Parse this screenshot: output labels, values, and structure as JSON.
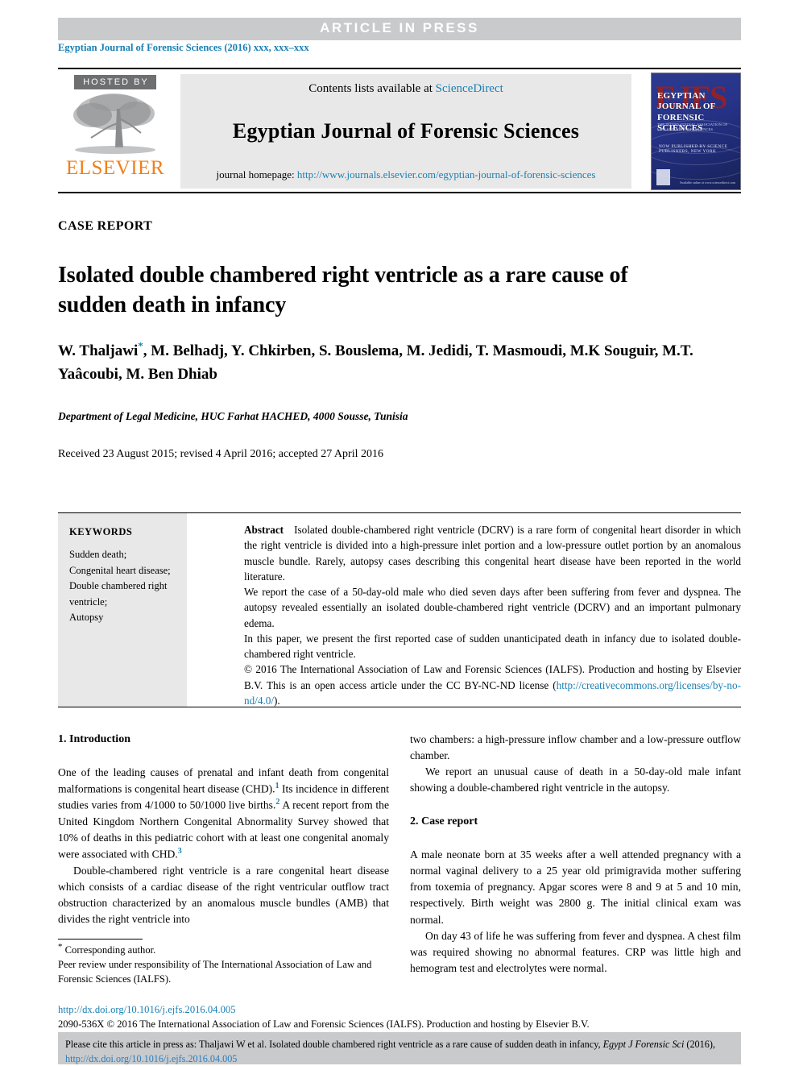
{
  "banner": {
    "text": "ARTICLE  IN  PRESS",
    "bg_color": "#c9cacc"
  },
  "issue_line": "Egyptian Journal of Forensic Sciences (2016) xxx, xxx–xxx",
  "masthead": {
    "hosted_by": "HOSTED BY",
    "publisher": "ELSEVIER",
    "contents_prefix": "Contents lists available at",
    "contents_link": "ScienceDirect",
    "journal_title": "Egyptian Journal of Forensic Sciences",
    "homepage_label": "journal homepage:",
    "homepage_url": "http://www.journals.elsevier.com/egyptian-journal-of-forensic-sciences",
    "cover": {
      "ghost_letters": "EJFS",
      "title": "EGYPTIAN JOURNAL OF FORENSIC SCIENCES",
      "subtitle": "THE INTERNATIONAL ASSOCIATION OF LAW AND FORENSIC SCIENCES",
      "middle_line": "NOW PUBLISHED BY SCIENCE PUBLISHERS, NEW YORK",
      "footer": "Available online at\nwww.sciencedirect.com"
    },
    "link_color": "#1a7fb3"
  },
  "article": {
    "type_label": "CASE REPORT",
    "title": "Isolated double chambered right ventricle as a rare cause of sudden death in infancy",
    "authors": "W. Thaljawi , M. Belhadj, Y. Chkirben, S. Bouslema, M. Jedidi, T. Masmoudi, M.K Souguir, M.T. Yaâcoubi, M. Ben Dhiab",
    "affiliation": "Department of Legal Medicine, HUC Farhat HACHED, 4000 Sousse, Tunisia",
    "dates": "Received 23 August 2015; revised 4 April 2016; accepted 27 April 2016"
  },
  "keywords": {
    "heading": "KEYWORDS",
    "items": [
      "Sudden death;",
      "Congenital heart disease;",
      "Double chambered right",
      "ventricle;",
      "Autopsy"
    ]
  },
  "abstract": {
    "label": "Abstract",
    "para1": "Isolated double-chambered right ventricle (DCRV) is a rare form of congenital heart disorder in which the right ventricle is divided into a high-pressure inlet portion and a low-pressure outlet portion by an anomalous muscle bundle. Rarely, autopsy cases describing this congenital heart disease have been reported in the world literature.",
    "para2": "We report the case of a 50-day-old male who died seven days after been suffering from fever and dyspnea. The autopsy revealed essentially an isolated double-chambered right ventricle (DCRV) and an important pulmonary edema.",
    "para3": "In this paper, we present the first reported case of sudden unanticipated death in infancy due to isolated double-chambered right ventricle.",
    "copyright": "© 2016 The International Association of Law and Forensic Sciences (IALFS). Production and hosting by Elsevier B.V. This is an open access article under the CC BY-NC-ND license (",
    "copyright_link": "http://creativecommons.org/licenses/by-no-nd/4.0/",
    "copyright_tail": ")."
  },
  "body": {
    "section1_heading": "1. Introduction",
    "left_p1_a": "One of the leading causes of prenatal and infant death from congenital malformations is congenital heart disease (CHD).",
    "left_p1_ref1": "1",
    "left_p1_b": " Its incidence in different studies varies from 4/1000 to 50/1000 live births.",
    "left_p1_ref2": "2",
    "left_p1_c": " A recent report from the United Kingdom Northern Congenital Abnormality Survey showed that 10% of deaths in this pediatric cohort with at least one congenital anomaly were associated with CHD.",
    "left_p1_ref3": "3",
    "left_p2": "Double-chambered right ventricle is a rare congenital heart disease which consists of a cardiac disease of the right ventricular outflow tract obstruction characterized by an anomalous muscle bundles (AMB) that divides the right ventricle into",
    "right_p1": "two chambers: a high-pressure inflow chamber and a low-pressure outflow chamber.",
    "right_p2": "We report an unusual cause of death in a 50-day-old male infant showing a double-chambered right ventricle in the autopsy.",
    "section2_heading": "2. Case report",
    "right_p3": "A male neonate born at 35 weeks after a well attended pregnancy with a normal vaginal delivery to a 25 year old primigravida mother suffering from toxemia of pregnancy. Apgar scores were 8 and 9 at 5 and 10 min, respectively. Birth weight was 2800 g. The initial clinical exam was normal.",
    "right_p4": "On day 43 of life he was suffering from fever and dyspnea. A chest film was required showing no abnormal features. CRP was little high and hemogram test and electrolytes were normal."
  },
  "footnotes": {
    "corresponding": "Corresponding author.",
    "peer_review": "Peer review under responsibility of The International Association of Law and Forensic Sciences (IALFS).",
    "doi_link": "http://dx.doi.org/10.1016/j.ejfs.2016.04.005",
    "issn_line": "2090-536X © 2016 The International Association of Law and Forensic Sciences (IALFS). Production and hosting by Elsevier B.V.",
    "license_line_prefix": "This is an open access article under the CC BY-NC-ND license (",
    "license_link": "http://creativecommons.org/licenses/by-no-nd/4.0/",
    "license_line_suffix": ")."
  },
  "cite_box": {
    "prefix": "Please cite this article in press as: Thaljawi W et al. Isolated double chambered right ventricle as a rare cause of sudden death in infancy, ",
    "journal_italic": "Egypt J Forensic Sci",
    "year": " (2016),",
    "link": "http://dx.doi.org/10.1016/j.ejfs.2016.04.005",
    "bg_color": "#c9cacc"
  }
}
